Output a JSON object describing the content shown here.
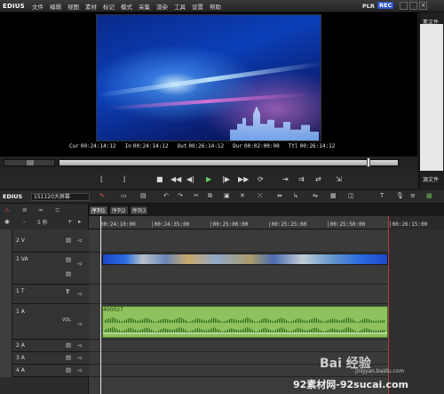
{
  "app": {
    "logo": "EDIUS"
  },
  "menu": [
    "文件",
    "编辑",
    "视图",
    "素材",
    "标记",
    "模式",
    "采集",
    "渲染",
    "工具",
    "设置",
    "帮助"
  ],
  "mode": {
    "plr": "PLR",
    "rec": "REC"
  },
  "preview": {
    "timecodes": [
      {
        "label": "Cur",
        "value": "00:24:14:12"
      },
      {
        "label": "In",
        "value": "00:24:14:12"
      },
      {
        "label": "Out",
        "value": "00:26:14:12"
      },
      {
        "label": "Dur",
        "value": "00:02:00:00"
      },
      {
        "label": "Ttl",
        "value": "00:26:14:12"
      }
    ]
  },
  "right_panel": {
    "tab_top": "素文件",
    "tab_bottom": "源文件"
  },
  "timeline": {
    "brand": "EDIUS",
    "project": "151120大屏幕",
    "sequence_tabs": [
      "序列1",
      "序列2",
      "序列3"
    ],
    "active_tab_index": 0,
    "ruler": [
      "00:24:10:00",
      "|00:24:35:00",
      "|00:25:00:00",
      "|00:25:25:00",
      "|00:25:50:00",
      "|00:26:15:00"
    ],
    "zoom": "5 秒",
    "tracks": {
      "v2": "2 V",
      "va1": "1 VA",
      "t1": "1 T",
      "a1": "1 A",
      "a2": "2 A",
      "a3": "3 A",
      "a4": "4 A",
      "vol": "VOL"
    },
    "audio_clip_label": "400027"
  },
  "watermark": {
    "baidu": "Bai 经验",
    "baidu_sub": "jingyan.baidu.com",
    "site": "92素材网-92sucai.com"
  },
  "colors": {
    "audio_clip": "#8fc25e",
    "rec_badge": "#2d55c9",
    "play": "#5fd05f"
  }
}
